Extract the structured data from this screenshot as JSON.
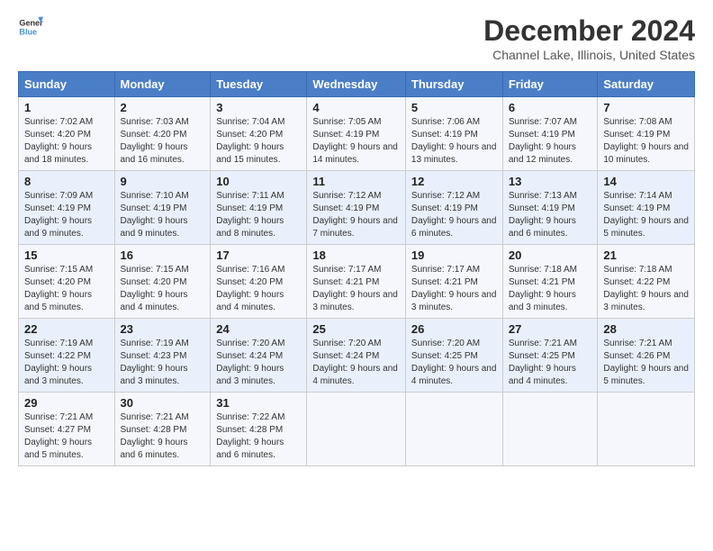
{
  "logo": {
    "line1": "General",
    "line2": "Blue"
  },
  "title": "December 2024",
  "subtitle": "Channel Lake, Illinois, United States",
  "days_of_week": [
    "Sunday",
    "Monday",
    "Tuesday",
    "Wednesday",
    "Thursday",
    "Friday",
    "Saturday"
  ],
  "weeks": [
    [
      {
        "day": "1",
        "sunrise": "7:02 AM",
        "sunset": "4:20 PM",
        "daylight": "9 hours and 18 minutes."
      },
      {
        "day": "2",
        "sunrise": "7:03 AM",
        "sunset": "4:20 PM",
        "daylight": "9 hours and 16 minutes."
      },
      {
        "day": "3",
        "sunrise": "7:04 AM",
        "sunset": "4:20 PM",
        "daylight": "9 hours and 15 minutes."
      },
      {
        "day": "4",
        "sunrise": "7:05 AM",
        "sunset": "4:19 PM",
        "daylight": "9 hours and 14 minutes."
      },
      {
        "day": "5",
        "sunrise": "7:06 AM",
        "sunset": "4:19 PM",
        "daylight": "9 hours and 13 minutes."
      },
      {
        "day": "6",
        "sunrise": "7:07 AM",
        "sunset": "4:19 PM",
        "daylight": "9 hours and 12 minutes."
      },
      {
        "day": "7",
        "sunrise": "7:08 AM",
        "sunset": "4:19 PM",
        "daylight": "9 hours and 10 minutes."
      }
    ],
    [
      {
        "day": "8",
        "sunrise": "7:09 AM",
        "sunset": "4:19 PM",
        "daylight": "9 hours and 9 minutes."
      },
      {
        "day": "9",
        "sunrise": "7:10 AM",
        "sunset": "4:19 PM",
        "daylight": "9 hours and 9 minutes."
      },
      {
        "day": "10",
        "sunrise": "7:11 AM",
        "sunset": "4:19 PM",
        "daylight": "9 hours and 8 minutes."
      },
      {
        "day": "11",
        "sunrise": "7:12 AM",
        "sunset": "4:19 PM",
        "daylight": "9 hours and 7 minutes."
      },
      {
        "day": "12",
        "sunrise": "7:12 AM",
        "sunset": "4:19 PM",
        "daylight": "9 hours and 6 minutes."
      },
      {
        "day": "13",
        "sunrise": "7:13 AM",
        "sunset": "4:19 PM",
        "daylight": "9 hours and 6 minutes."
      },
      {
        "day": "14",
        "sunrise": "7:14 AM",
        "sunset": "4:19 PM",
        "daylight": "9 hours and 5 minutes."
      }
    ],
    [
      {
        "day": "15",
        "sunrise": "7:15 AM",
        "sunset": "4:20 PM",
        "daylight": "9 hours and 5 minutes."
      },
      {
        "day": "16",
        "sunrise": "7:15 AM",
        "sunset": "4:20 PM",
        "daylight": "9 hours and 4 minutes."
      },
      {
        "day": "17",
        "sunrise": "7:16 AM",
        "sunset": "4:20 PM",
        "daylight": "9 hours and 4 minutes."
      },
      {
        "day": "18",
        "sunrise": "7:17 AM",
        "sunset": "4:21 PM",
        "daylight": "9 hours and 3 minutes."
      },
      {
        "day": "19",
        "sunrise": "7:17 AM",
        "sunset": "4:21 PM",
        "daylight": "9 hours and 3 minutes."
      },
      {
        "day": "20",
        "sunrise": "7:18 AM",
        "sunset": "4:21 PM",
        "daylight": "9 hours and 3 minutes."
      },
      {
        "day": "21",
        "sunrise": "7:18 AM",
        "sunset": "4:22 PM",
        "daylight": "9 hours and 3 minutes."
      }
    ],
    [
      {
        "day": "22",
        "sunrise": "7:19 AM",
        "sunset": "4:22 PM",
        "daylight": "9 hours and 3 minutes."
      },
      {
        "day": "23",
        "sunrise": "7:19 AM",
        "sunset": "4:23 PM",
        "daylight": "9 hours and 3 minutes."
      },
      {
        "day": "24",
        "sunrise": "7:20 AM",
        "sunset": "4:24 PM",
        "daylight": "9 hours and 3 minutes."
      },
      {
        "day": "25",
        "sunrise": "7:20 AM",
        "sunset": "4:24 PM",
        "daylight": "9 hours and 4 minutes."
      },
      {
        "day": "26",
        "sunrise": "7:20 AM",
        "sunset": "4:25 PM",
        "daylight": "9 hours and 4 minutes."
      },
      {
        "day": "27",
        "sunrise": "7:21 AM",
        "sunset": "4:25 PM",
        "daylight": "9 hours and 4 minutes."
      },
      {
        "day": "28",
        "sunrise": "7:21 AM",
        "sunset": "4:26 PM",
        "daylight": "9 hours and 5 minutes."
      }
    ],
    [
      {
        "day": "29",
        "sunrise": "7:21 AM",
        "sunset": "4:27 PM",
        "daylight": "9 hours and 5 minutes."
      },
      {
        "day": "30",
        "sunrise": "7:21 AM",
        "sunset": "4:28 PM",
        "daylight": "9 hours and 6 minutes."
      },
      {
        "day": "31",
        "sunrise": "7:22 AM",
        "sunset": "4:28 PM",
        "daylight": "9 hours and 6 minutes."
      },
      null,
      null,
      null,
      null
    ]
  ]
}
